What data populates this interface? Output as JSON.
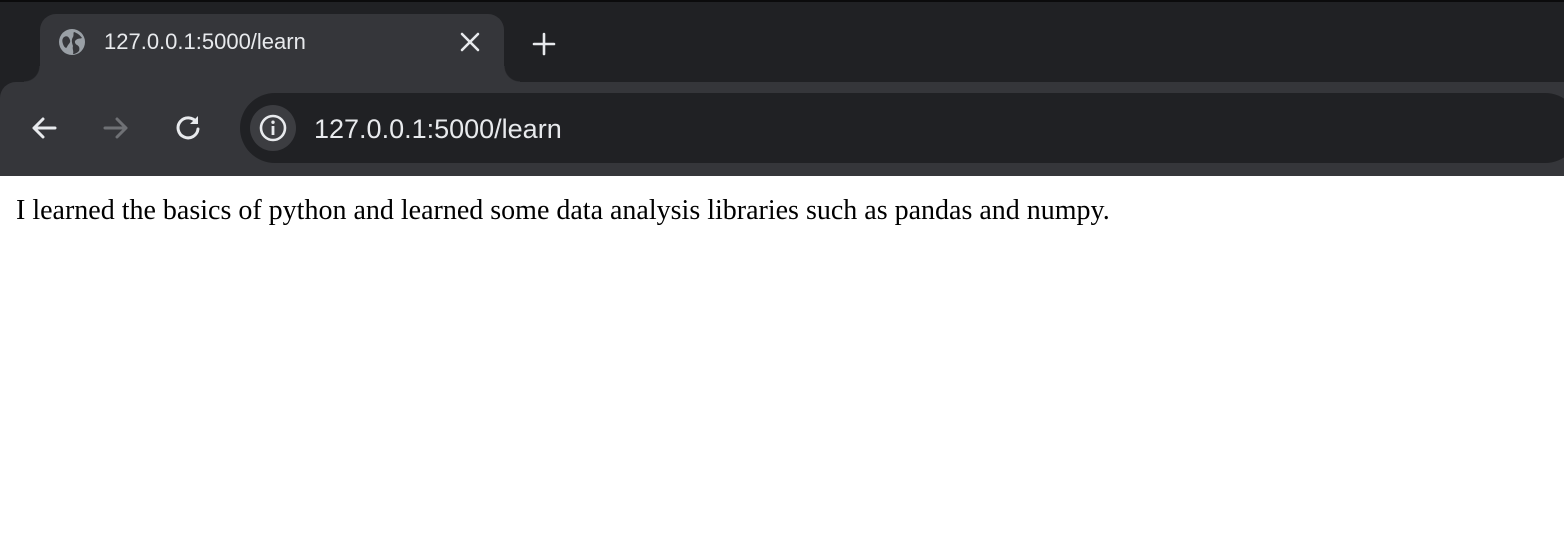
{
  "browser": {
    "tab": {
      "title": "127.0.0.1:5000/learn",
      "favicon": "globe-icon",
      "close_icon": "close-icon"
    },
    "new_tab_icon": "plus-icon",
    "toolbar": {
      "back_icon": "arrow-left-icon",
      "forward_icon": "arrow-right-icon",
      "reload_icon": "reload-icon",
      "site_info_icon": "info-icon",
      "url": "127.0.0.1:5000/learn"
    },
    "colors": {
      "chrome_dark": "#202124",
      "chrome_tab": "#35363a",
      "text_light": "#e8eaed",
      "icon_muted": "#9aa0a6",
      "icon_disabled": "#6f7175"
    }
  },
  "page": {
    "body_text": "I learned the basics of python and learned some data analysis libraries such as pandas and numpy."
  }
}
